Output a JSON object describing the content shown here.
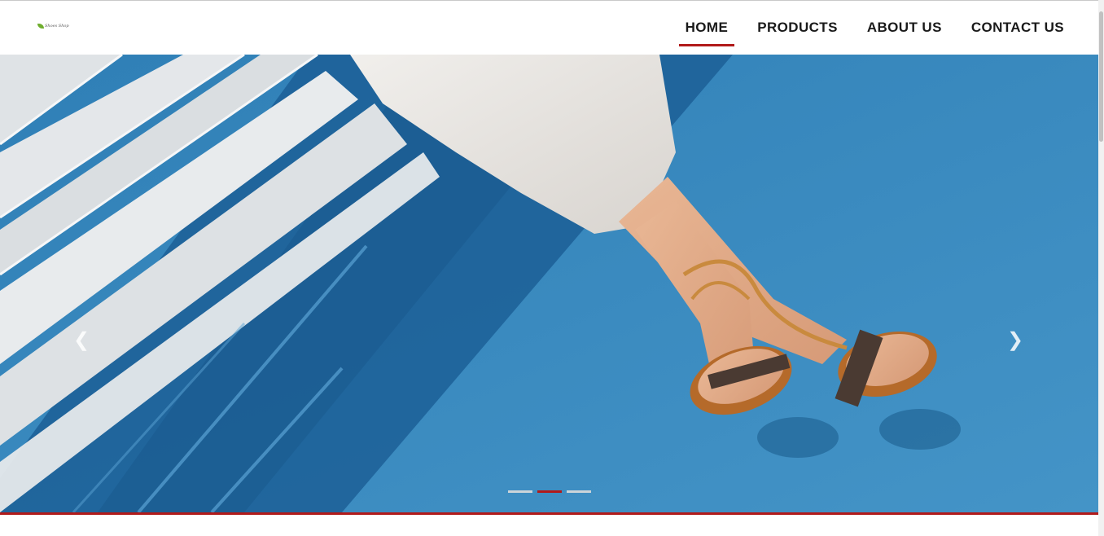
{
  "header": {
    "logo_text": "Shoes Shop",
    "nav": [
      {
        "label": "HOME",
        "active": true
      },
      {
        "label": "PRODUCTS",
        "active": false
      },
      {
        "label": "ABOUT US",
        "active": false
      },
      {
        "label": "CONTACT US",
        "active": false
      }
    ]
  },
  "carousel": {
    "prev_icon": "chevron-left-icon",
    "next_icon": "chevron-right-icon",
    "prev_glyph": "❮",
    "next_glyph": "❯",
    "slide_count": 3,
    "active_index": 1
  },
  "colors": {
    "accent": "#b11a1a",
    "floor": "#3b89bd"
  }
}
